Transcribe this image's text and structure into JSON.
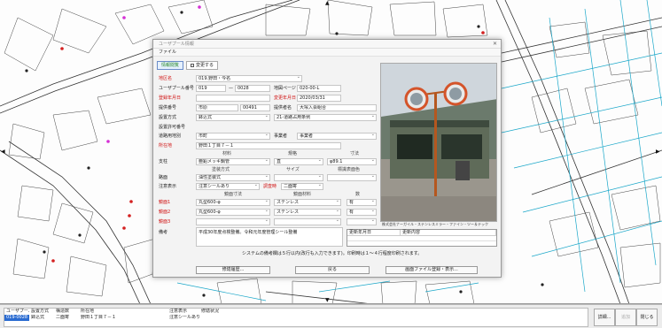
{
  "dialog": {
    "title": "ユーザプール情報",
    "close_glyph": "✕",
    "menu": "ファイル",
    "mode_view": "情報閲覧",
    "mode_edit": "変更する"
  },
  "form": {
    "area_label": "地区名",
    "area_value": "019.野田・今名",
    "pole_no_label": "ユーザプール番号",
    "pole_no_from": "019",
    "pole_no_sep": "—",
    "pole_no_to": "0028",
    "map_page_label": "地図ページ",
    "map_page_value": "020-00-L",
    "reg_date_label": "登録年月日",
    "reg_date_value": "",
    "change_date_label": "変更年月日",
    "change_date_value": "2020/03/31",
    "owner_no_label": "提供番号",
    "owner_no_city": "市原",
    "owner_no_value": "00491",
    "owner_name_label": "提供者名",
    "owner_name_value": "大塚入会組合",
    "install_label": "設置方式",
    "install_value": "鉢込式",
    "install_kind_value": "21-道路占用条例",
    "mgmt_no_label": "設置許可番号",
    "permit_label": "道路用地別",
    "permit_value": "市町",
    "type_label": "事業者",
    "type_value": "事業者",
    "addr_label": "所在地",
    "addr_value": "野田１丁目７－１",
    "material_hdr": "材料",
    "spec_hdr": "規格",
    "size_hdr": "寸法",
    "pole_label": "支柱",
    "pole_material": "亜鉛メッキ鋼管",
    "pole_spec": "直",
    "pole_size": "φ89.1",
    "paint_method_hdr": "塗装方式",
    "paint_size_hdr": "サイズ",
    "paint_color_hdr": "標識表面色",
    "sign_label": "路面",
    "sign_value": "油性塗装式",
    "note_display_label": "注意表示",
    "note_display_value": "注意シールあり",
    "mgmt_label": "調査時",
    "mgmt_value": "二面寄",
    "mirror_shape_hdr": "鏡面寸法",
    "mirror_material_hdr": "鏡面材料",
    "mirror_count_hdr": "数",
    "mirror1_label": "鏡面1",
    "mirror1_shape": "丸型600-φ",
    "mirror1_material": "ステンレス",
    "mirror1_count": "有",
    "mirror2_label": "鏡面2",
    "mirror2_shape": "丸型600-φ",
    "mirror2_material": "ステンレス",
    "mirror2_count": "有",
    "mirror3_label": "鏡面3",
    "remarks_label": "備考",
    "remarks_value": "平成30年度点検整備。令和元年度管理シール整備",
    "hist_col1": "更新年月日",
    "hist_col2": "更新内容",
    "hist_row1": "",
    "hint": "システムの備考欄は５行以内(改行も入力できます)。印刷時は１～４行程度印刷されます。",
    "btn_edit_photo": "修繕履歴...",
    "btn_back": "戻る",
    "btn_photo_print": "画面ファイル登録・表示..."
  },
  "photo_caption": "株式会社ナーガイル・ステンレスミラー・ファイン・ツー＆テック",
  "status": {
    "headers": [
      "ユーザプール",
      "設置方式",
      "構造数",
      "所在地",
      "注意表示",
      "修繕状況"
    ],
    "row": [
      "019-0028",
      "鉢込式",
      "二面寄",
      "野田１丁目７－１",
      "注意シールあり",
      ""
    ],
    "btn_detail": "詳細...",
    "btn_add": "追加",
    "btn_close": "閉じる"
  },
  "colors": {
    "accent": "#2a6bd1",
    "required_label": "#d01010",
    "map_roads": "#1aa7c9",
    "map_lines": "#333333",
    "marker_red": "#d42020",
    "marker_magenta": "#d52fd5"
  }
}
